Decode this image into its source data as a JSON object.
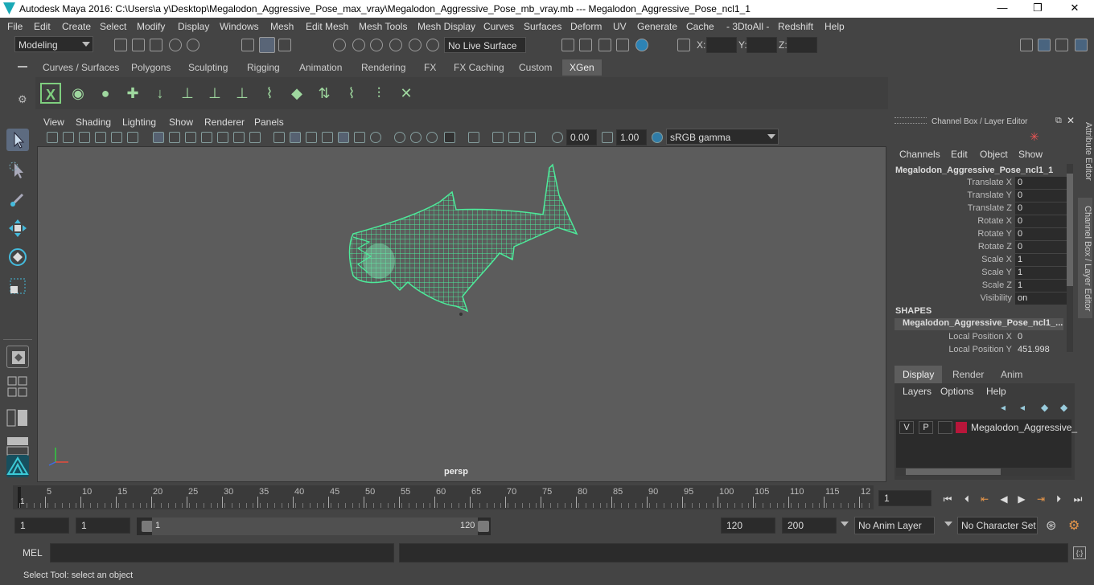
{
  "window": {
    "title": "Autodesk Maya 2016: C:\\Users\\a y\\Desktop\\Megalodon_Aggressive_Pose_max_vray\\Megalodon_Aggressive_Pose_mb_vray.mb  ---  Megalodon_Aggressive_Pose_ncl1_1",
    "minimize": "—",
    "maximize": "❐",
    "close": "✕"
  },
  "menubar": [
    "File",
    "Edit",
    "Create",
    "Select",
    "Modify",
    "Display",
    "Windows",
    "Mesh",
    "Edit Mesh",
    "Mesh Tools",
    "Mesh Display",
    "Curves",
    "Surfaces",
    "Deform",
    "UV",
    "Generate",
    "Cache",
    "- 3DtoAll -",
    "Redshift",
    "Help"
  ],
  "statusline": {
    "mode": "Modeling",
    "live_surface": "No Live Surface",
    "x_label": "X:",
    "y_label": "Y:",
    "z_label": "Z:"
  },
  "shelf_tabs": [
    "Curves / Surfaces",
    "Polygons",
    "Sculpting",
    "Rigging",
    "Animation",
    "Rendering",
    "FX",
    "FX Caching",
    "Custom",
    "XGen"
  ],
  "shelf_active": "XGen",
  "viewport": {
    "menus": [
      "View",
      "Shading",
      "Lighting",
      "Show",
      "Renderer",
      "Panels"
    ],
    "exposure": "0.00",
    "gamma": "1.00",
    "colorspace": "sRGB gamma",
    "camera_label": "persp",
    "wire_color": "#4dea9a"
  },
  "channel_box": {
    "header": "Channel Box / Layer Editor",
    "menus": [
      "Channels",
      "Edit",
      "Object",
      "Show"
    ],
    "object_name": "Megalodon_Aggressive_Pose_ncl1_1",
    "attributes": [
      {
        "label": "Translate X",
        "value": "0"
      },
      {
        "label": "Translate Y",
        "value": "0"
      },
      {
        "label": "Translate Z",
        "value": "0"
      },
      {
        "label": "Rotate X",
        "value": "0"
      },
      {
        "label": "Rotate Y",
        "value": "0"
      },
      {
        "label": "Rotate Z",
        "value": "0"
      },
      {
        "label": "Scale X",
        "value": "1"
      },
      {
        "label": "Scale Y",
        "value": "1"
      },
      {
        "label": "Scale Z",
        "value": "1"
      },
      {
        "label": "Visibility",
        "value": "on"
      }
    ],
    "shapes_header": "SHAPES",
    "shape_name": "Megalodon_Aggressive_Pose_ncl1_...",
    "shape_attributes": [
      {
        "label": "Local Position X",
        "value": "0"
      },
      {
        "label": "Local Position Y",
        "value": "451.998"
      }
    ]
  },
  "side_tabs": {
    "attribute_editor": "Attribute Editor",
    "channel_box": "Channel Box / Layer Editor"
  },
  "layer_editor": {
    "tabs": [
      "Display",
      "Render",
      "Anim"
    ],
    "active_tab": "Display",
    "menus": [
      "Layers",
      "Options",
      "Help"
    ],
    "layer": {
      "v": "V",
      "p": "P",
      "name": "Megalodon_Aggressive_",
      "color": "#b8163a"
    }
  },
  "timeline": {
    "ticks": [
      "5",
      "10",
      "15",
      "20",
      "25",
      "30",
      "35",
      "40",
      "45",
      "50",
      "55",
      "60",
      "65",
      "70",
      "75",
      "80",
      "85",
      "90",
      "95",
      "100",
      "105",
      "110",
      "115",
      "12"
    ],
    "start_marker": "1",
    "current_frame": "1"
  },
  "range": {
    "start": "1",
    "inner_start": "1",
    "slider_start": "1",
    "slider_end": "120",
    "end": "120",
    "outer_end": "200",
    "anim_layer": "No Anim Layer",
    "char_set": "No Character Set"
  },
  "mel": {
    "label": "MEL"
  },
  "help_line": "Select Tool: select an object"
}
